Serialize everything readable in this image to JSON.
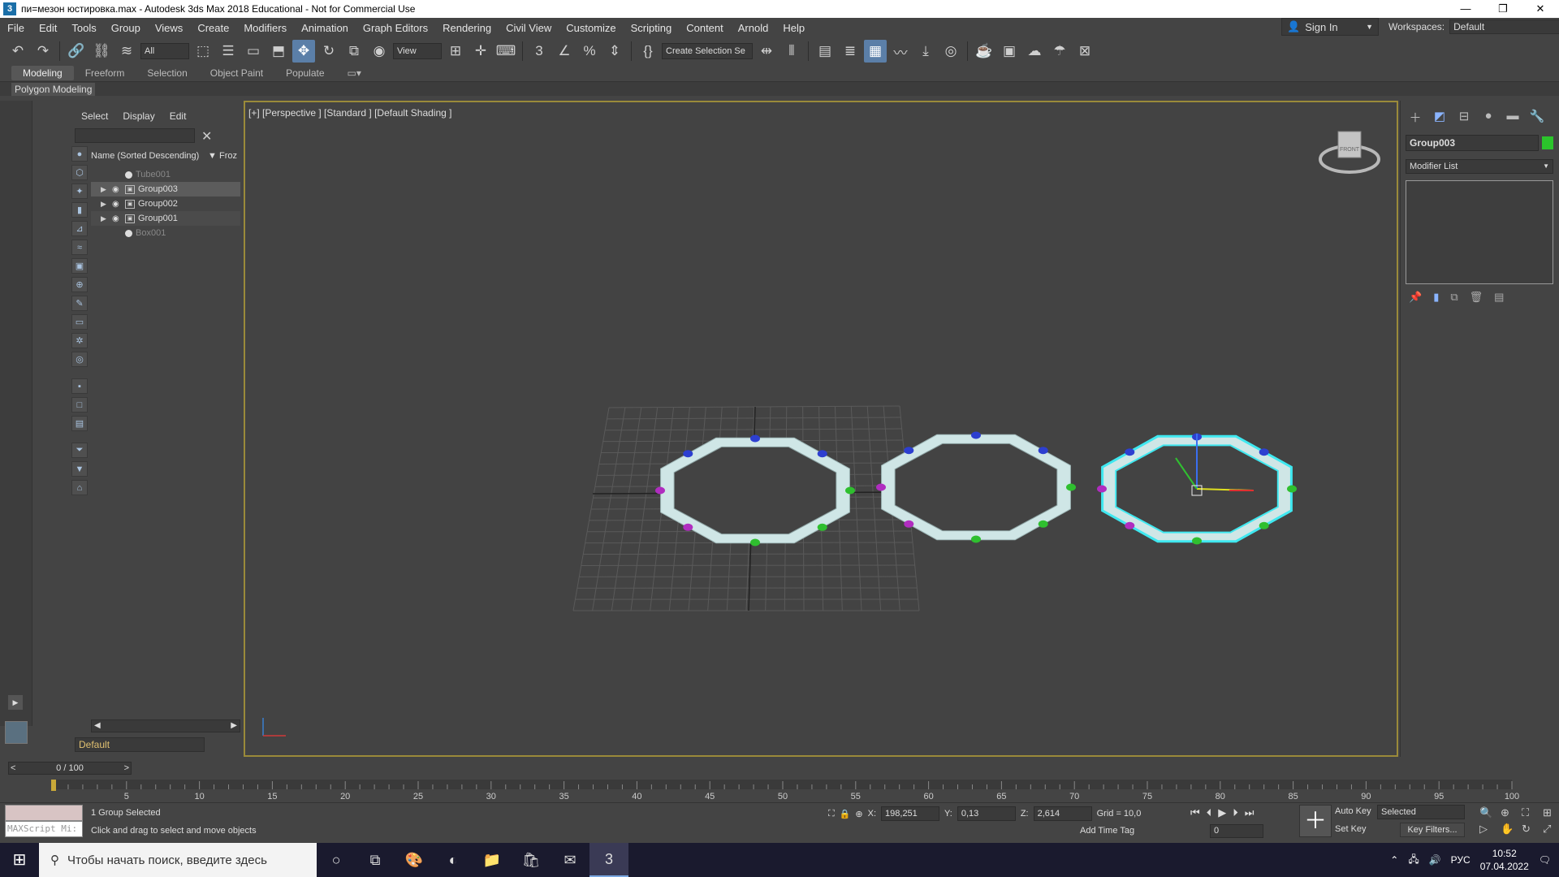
{
  "window": {
    "title": "пи=мезон юстировка.max - Autodesk 3ds Max 2018 Educational - Not for Commercial Use",
    "controls": [
      "—",
      "❐",
      "✕"
    ]
  },
  "menu": {
    "items": [
      "File",
      "Edit",
      "Tools",
      "Group",
      "Views",
      "Create",
      "Modifiers",
      "Animation",
      "Graph Editors",
      "Rendering",
      "Civil View",
      "Customize",
      "Scripting",
      "Content",
      "Arnold",
      "Help"
    ],
    "sign_in": "Sign In",
    "workspaces_label": "Workspaces:",
    "workspaces_value": "Default"
  },
  "toolbar": {
    "filter": "All",
    "ref_coord": "View",
    "selection_set": "Create Selection Se"
  },
  "ribbon": {
    "tabs": [
      "Modeling",
      "Freeform",
      "Selection",
      "Object Paint",
      "Populate"
    ],
    "active": "Modeling",
    "sub": "Polygon Modeling"
  },
  "explorer": {
    "tabs": [
      "Select",
      "Display",
      "Edit"
    ],
    "col_name": "Name (Sorted Descending)",
    "col_frozen": "▼ Froz",
    "rows": [
      {
        "name": "Tube001",
        "kind": "dim"
      },
      {
        "name": "Group003",
        "kind": "group-sel"
      },
      {
        "name": "Group002",
        "kind": "group"
      },
      {
        "name": "Group001",
        "kind": "group"
      },
      {
        "name": "Box001",
        "kind": "dim"
      }
    ],
    "layer": "Default"
  },
  "viewport": {
    "label": "[+] [Perspective ] [Standard ] [Default Shading ]",
    "viewcube_text": "FRONT"
  },
  "command_panel": {
    "object_name": "Group003",
    "object_color": "#2bc42b",
    "modifier_list": "Modifier List"
  },
  "timeline": {
    "slider": "0 / 100",
    "ticks": [
      "5",
      "10",
      "15",
      "20",
      "25",
      "30",
      "35",
      "40",
      "45",
      "50",
      "55",
      "60",
      "65",
      "70",
      "75",
      "80",
      "85",
      "90",
      "95",
      "100"
    ]
  },
  "status": {
    "maxscript": "MAXScript Mi:",
    "selection": "1 Group Selected",
    "prompt": "Click and drag to select and move objects",
    "x_label": "X:",
    "x_value": "198,251",
    "y_label": "Y:",
    "y_value": "0,13",
    "z_label": "Z:",
    "z_value": "2,614",
    "grid": "Grid = 10,0",
    "add_time_tag": "Add Time Tag",
    "frame": "0",
    "auto_key": "Auto Key",
    "set_key": "Set Key",
    "selected": "Selected",
    "key_filters": "Key Filters..."
  },
  "taskbar": {
    "search_placeholder": "Чтобы начать поиск, введите здесь",
    "lang": "РУС",
    "time": "10:52",
    "date": "07.04.2022"
  }
}
